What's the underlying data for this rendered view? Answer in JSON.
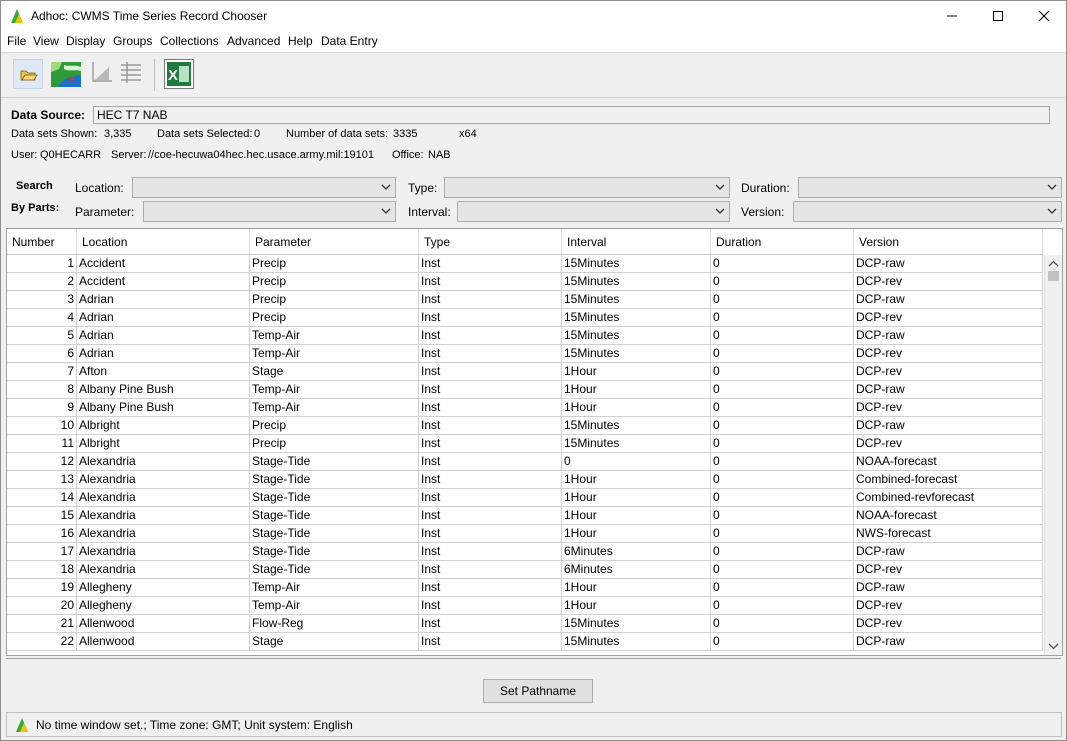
{
  "window": {
    "title": "Adhoc: CWMS Time Series Record Chooser",
    "minimize_glyph": "—",
    "maximize_glyph": "☐",
    "close_glyph": "✕"
  },
  "menu": [
    "File",
    "View",
    "Display",
    "Groups",
    "Collections",
    "Advanced",
    "Help",
    "Data Entry"
  ],
  "toolbar": {
    "icons": [
      "open-folder-icon",
      "map-icon",
      "plot-icon",
      "table-icon",
      "excel-icon"
    ],
    "excel_letter": "X"
  },
  "info": {
    "data_source_label": "Data Source:",
    "data_source_value": "HEC T7 NAB",
    "shown_label": "Data sets Shown:",
    "shown_value": "3,335",
    "selected_label": "Data sets Selected:",
    "selected_value": "0",
    "number_label": "Number of data sets:",
    "number_value": "3335",
    "arch": "x64",
    "user_label": "User:",
    "user_value": "Q0HECARR",
    "server_label": "Server:",
    "server_value": "//coe-hecuwa04hec.hec.usace.army.mil:19101",
    "office_label": "Office:",
    "office_value": "NAB"
  },
  "search": {
    "title_line1": "Search",
    "title_line2": "By Parts:",
    "location_label": "Location:",
    "type_label": "Type:",
    "duration_label": "Duration:",
    "parameter_label": "Parameter:",
    "interval_label": "Interval:",
    "version_label": "Version:"
  },
  "table": {
    "columns": [
      "Number",
      "Location",
      "Parameter",
      "Type",
      "Interval",
      "Duration",
      "Version"
    ],
    "rows": [
      [
        "1",
        "Accident",
        "Precip",
        "Inst",
        "15Minutes",
        "0",
        "DCP-raw"
      ],
      [
        "2",
        "Accident",
        "Precip",
        "Inst",
        "15Minutes",
        "0",
        "DCP-rev"
      ],
      [
        "3",
        "Adrian",
        "Precip",
        "Inst",
        "15Minutes",
        "0",
        "DCP-raw"
      ],
      [
        "4",
        "Adrian",
        "Precip",
        "Inst",
        "15Minutes",
        "0",
        "DCP-rev"
      ],
      [
        "5",
        "Adrian",
        "Temp-Air",
        "Inst",
        "15Minutes",
        "0",
        "DCP-raw"
      ],
      [
        "6",
        "Adrian",
        "Temp-Air",
        "Inst",
        "15Minutes",
        "0",
        "DCP-rev"
      ],
      [
        "7",
        "Afton",
        "Stage",
        "Inst",
        "1Hour",
        "0",
        "DCP-rev"
      ],
      [
        "8",
        "Albany Pine Bush",
        "Temp-Air",
        "Inst",
        "1Hour",
        "0",
        "DCP-raw"
      ],
      [
        "9",
        "Albany Pine Bush",
        "Temp-Air",
        "Inst",
        "1Hour",
        "0",
        "DCP-rev"
      ],
      [
        "10",
        "Albright",
        "Precip",
        "Inst",
        "15Minutes",
        "0",
        "DCP-raw"
      ],
      [
        "11",
        "Albright",
        "Precip",
        "Inst",
        "15Minutes",
        "0",
        "DCP-rev"
      ],
      [
        "12",
        "Alexandria",
        "Stage-Tide",
        "Inst",
        "0",
        "0",
        "NOAA-forecast"
      ],
      [
        "13",
        "Alexandria",
        "Stage-Tide",
        "Inst",
        "1Hour",
        "0",
        "Combined-forecast"
      ],
      [
        "14",
        "Alexandria",
        "Stage-Tide",
        "Inst",
        "1Hour",
        "0",
        "Combined-revforecast"
      ],
      [
        "15",
        "Alexandria",
        "Stage-Tide",
        "Inst",
        "1Hour",
        "0",
        "NOAA-forecast"
      ],
      [
        "16",
        "Alexandria",
        "Stage-Tide",
        "Inst",
        "1Hour",
        "0",
        "NWS-forecast"
      ],
      [
        "17",
        "Alexandria",
        "Stage-Tide",
        "Inst",
        "6Minutes",
        "0",
        "DCP-raw"
      ],
      [
        "18",
        "Alexandria",
        "Stage-Tide",
        "Inst",
        "6Minutes",
        "0",
        "DCP-rev"
      ],
      [
        "19",
        "Allegheny",
        "Temp-Air",
        "Inst",
        "1Hour",
        "0",
        "DCP-raw"
      ],
      [
        "20",
        "Allegheny",
        "Temp-Air",
        "Inst",
        "1Hour",
        "0",
        "DCP-rev"
      ],
      [
        "21",
        "Allenwood",
        "Flow-Reg",
        "Inst",
        "15Minutes",
        "0",
        "DCP-rev"
      ],
      [
        "22",
        "Allenwood",
        "Stage",
        "Inst",
        "15Minutes",
        "0",
        "DCP-raw"
      ]
    ]
  },
  "buttons": {
    "set_pathname": "Set Pathname"
  },
  "status": {
    "text": "No time window set.;  Time zone: GMT;  Unit system: English"
  }
}
